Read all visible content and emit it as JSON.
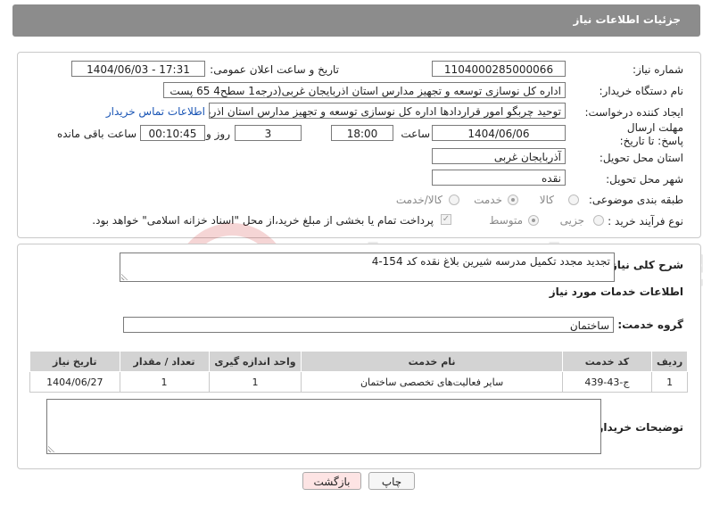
{
  "header": {
    "title": "جزئیات اطلاعات نیاز"
  },
  "form": {
    "need_number": {
      "label": "شماره نیاز:",
      "value": "1104000285000066"
    },
    "announce_datetime": {
      "label": "تاریخ و ساعت اعلان عمومی:",
      "value": "1404/06/03 - 17:31"
    },
    "buyer_org": {
      "label": "نام دستگاه خریدار:",
      "value": "اداره کل نوسازی   توسعه و تجهیز مدارس استان اذربایجان غربی(درجه1  سطح4  65 پست"
    },
    "requester": {
      "label": "ایجاد کننده درخواست:",
      "value": "توحید چربگو امور قراردادها اداره کل نوسازی   توسعه و تجهیز مدارس استان اذربا",
      "contact_link": "اطلاعات تماس خریدار"
    },
    "deadline": {
      "label": "مهلت ارسال پاسخ: تا تاریخ:",
      "date": "1404/06/06",
      "time_label": "ساعت",
      "time": "18:00",
      "days": "3",
      "days_label": "روز و",
      "remaining": "00:10:45",
      "remaining_label": "ساعت باقی مانده"
    },
    "province": {
      "label": "استان محل تحویل:",
      "value": "آذربایجان غربی"
    },
    "city": {
      "label": "شهر محل تحویل:",
      "value": "نقده"
    },
    "category": {
      "label": "طبقه بندی موضوعی:",
      "options": [
        "کالا",
        "خدمت",
        "کالا/خدمت"
      ],
      "selected": "خدمت"
    },
    "purchase_type": {
      "label": "نوع فرآیند خرید :",
      "options": [
        "جزیی",
        "متوسط"
      ],
      "selected": "متوسط",
      "payment_note": "پرداخت تمام یا بخشی از مبلغ خرید،از محل \"اسناد خزانه اسلامی\" خواهد بود."
    }
  },
  "summary": {
    "label": "شرح کلی نیاز:",
    "value": "تجدید مجدد تکمیل مدرسه شیرین بلاغ نقده کد 154-4"
  },
  "services": {
    "section_title": "اطلاعات خدمات مورد نیاز",
    "group_label": "گروه خدمت:",
    "group_value": "ساختمان",
    "columns": [
      "ردیف",
      "کد خدمت",
      "نام خدمت",
      "واحد اندازه گیری",
      "تعداد / مقدار",
      "تاریخ نیاز"
    ],
    "rows": [
      {
        "index": "1",
        "code": "ج-43-439",
        "name": "سایر فعالیت‌های تخصصی ساختمان",
        "unit": "1",
        "qty": "1",
        "date": "1404/06/27"
      }
    ]
  },
  "buyer_notes": {
    "label": "توضیحات خریدار:",
    "value": ""
  },
  "buttons": {
    "print": "چاپ",
    "back": "بازگشت"
  },
  "watermark": {
    "text": "AriaTender.neT"
  },
  "colors": {
    "header_bg": "#8c8c8c",
    "table_header_bg": "#d3d3d3",
    "back_button_bg": "#fde4e4",
    "link": "#1a55b5"
  }
}
